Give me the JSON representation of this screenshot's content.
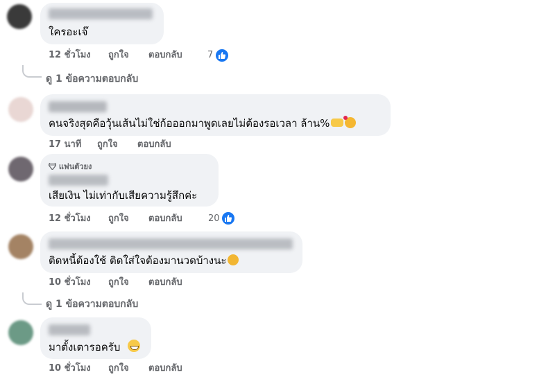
{
  "comments": [
    {
      "text": "ใครอะเจ๊",
      "time": "12 ชั่วโมง",
      "like_label": "ถูกใจ",
      "reply_label": "ตอบกลับ",
      "reactions": "7",
      "replies": "ดู 1 ข้อความตอบกลับ"
    },
    {
      "text": "คนจริงสุดคือวุ้นเส้นไม่ใช่ก้อออกมาพูดเลยไม่ต้องรอเวลา ล้าน%",
      "time": "17 นาที",
      "like_label": "ถูกใจ",
      "reply_label": "ตอบกลับ"
    },
    {
      "badge": "แฟนตัวยง",
      "text": "เสียเงิน ไม่เท่ากับเสียความรู้สึกค่ะ",
      "time": "12 ชั่วโมง",
      "like_label": "ถูกใจ",
      "reply_label": "ตอบกลับ",
      "reactions": "20"
    },
    {
      "text": "ติดหนี้ต้องใช้ ติดใส่ใจต้องมานวดบ้างนะ",
      "time": "10 ชั่วโมง",
      "like_label": "ถูกใจ",
      "reply_label": "ตอบกลับ",
      "replies": "ดู 1 ข้อความตอบกลับ"
    },
    {
      "text": "มาตั้งเตารอครับ",
      "time": "10 ชั่วโมง",
      "like_label": "ถูกใจ",
      "reply_label": "ตอบกลับ"
    }
  ],
  "colors": {
    "bubble": "#f0f2f5",
    "meta_text": "#65676b",
    "like_blue": "#1877f2"
  },
  "icons": [
    "avatar",
    "like-thumb-icon",
    "diamond-badge-icon",
    "heart-hands-emoji",
    "smiling-hearts-emoji",
    "sweat-smile-emoji",
    "grin-emoji"
  ]
}
